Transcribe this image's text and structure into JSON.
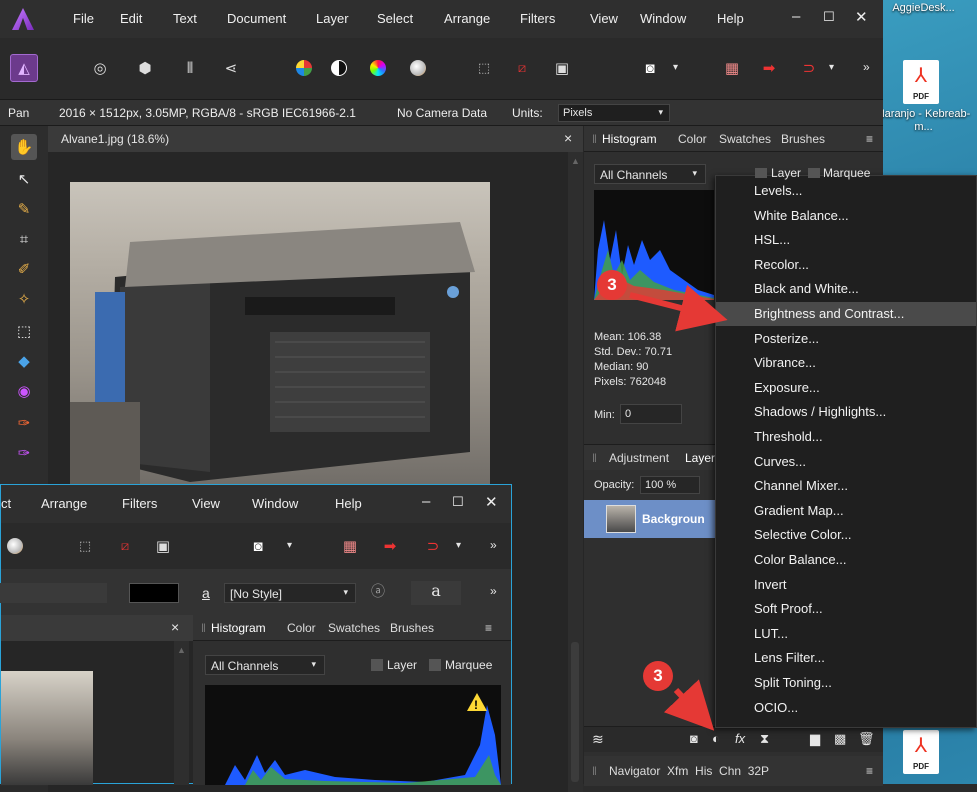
{
  "desktop": {
    "top_label": "AggieDesk...",
    "file1_label": "Naranjo - Kebreab- m...",
    "pdf_text": "PDF"
  },
  "menubar": {
    "items": [
      "File",
      "Edit",
      "Text",
      "Document",
      "Layer",
      "Select",
      "Arrange",
      "Filters",
      "View",
      "Window",
      "Help"
    ]
  },
  "context": {
    "tool": "Pan",
    "doc_info": "2016 × 1512px, 3.05MP, RGBA/8 - sRGB IEC61966-2.1",
    "camera": "No Camera Data",
    "units_label": "Units:",
    "units_value": "Pixels"
  },
  "document": {
    "tab_title": "Alvane1.jpg (18.6%)",
    "close": "×"
  },
  "panel": {
    "tabs": [
      "Histogram",
      "Color",
      "Swatches",
      "Brushes"
    ],
    "channel": "All Channels",
    "layer_cb": "Layer",
    "marquee_cb": "Marquee",
    "stats": [
      "Mean: 106.38",
      "Std. Dev.: 70.71",
      "Median: 90",
      "Pixels: 762048"
    ],
    "min_label": "Min:",
    "min_value": "0",
    "adj_tab": "Adjustment",
    "layer_tab": "Layer",
    "opacity_label": "Opacity:",
    "opacity_value": "100 %",
    "layer_name": "Backgroun",
    "bottom_tabs": "Navigator  Xfm  His  Chn  32P"
  },
  "adjustment_menu": {
    "items": [
      "Levels...",
      "White Balance...",
      "HSL...",
      "Recolor...",
      "Black and White...",
      "Brightness and Contrast...",
      "Posterize...",
      "Vibrance...",
      "Exposure...",
      "Shadows / Highlights...",
      "Threshold...",
      "Curves...",
      "Channel Mixer...",
      "Gradient Map...",
      "Selective Color...",
      "Color Balance...",
      "Invert",
      "Soft Proof...",
      "LUT...",
      "Lens Filter...",
      "Split Toning...",
      "OCIO..."
    ],
    "highlighted": "Brightness and Contrast..."
  },
  "window2": {
    "menu": [
      "ct",
      "Arrange",
      "Filters",
      "View",
      "Window",
      "Help"
    ],
    "style_value": "[No Style]",
    "tabs": [
      "Histogram",
      "Color",
      "Swatches",
      "Brushes"
    ],
    "channel": "All Channels",
    "layer_cb": "Layer",
    "marquee_cb": "Marquee",
    "close": "×"
  },
  "annotations": {
    "badge1": "3",
    "badge2": "3"
  },
  "colors": {
    "accent_blue": "#2aa3d8",
    "badge_red": "#e53935",
    "layer_select": "#6d8fc7"
  }
}
